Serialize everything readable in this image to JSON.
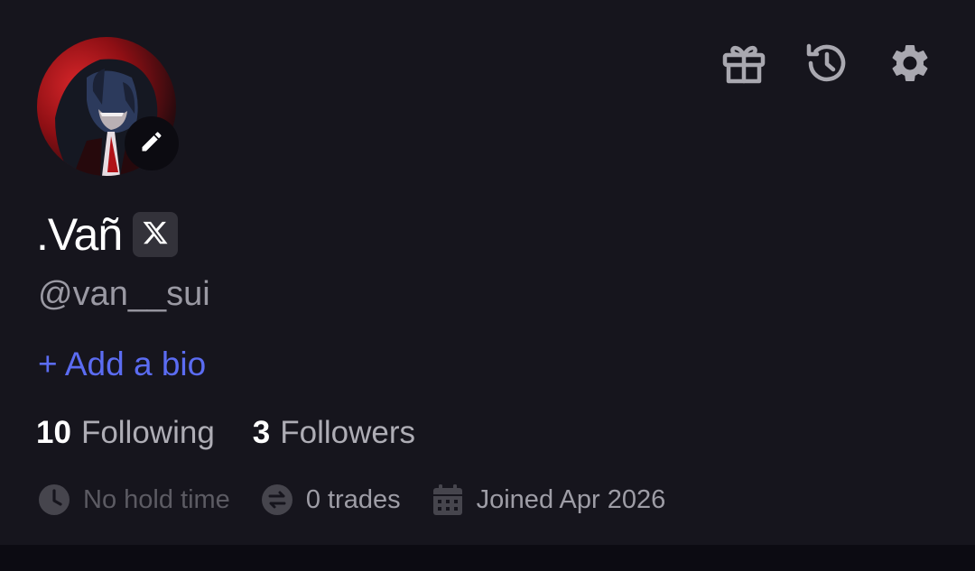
{
  "profile": {
    "display_name": ".Vañ",
    "handle": "@van__sui",
    "add_bio_label": "+ Add a bio",
    "stats": {
      "following_count": "10",
      "following_label": "Following",
      "followers_count": "3",
      "followers_label": "Followers"
    },
    "meta": {
      "hold_time": "No hold time",
      "trades": "0 trades",
      "joined": "Joined Apr 2026"
    }
  },
  "icons": {
    "gift": "gift-icon",
    "history": "history-icon",
    "settings": "gear-icon",
    "edit": "pencil-icon",
    "x_badge": "x-logo-icon",
    "clock": "clock-icon",
    "trades": "swap-icon",
    "calendar": "calendar-icon"
  },
  "colors": {
    "background": "#16151d",
    "accent": "#5b6cf2",
    "muted_text": "#9a99a3",
    "dim_text": "#5c5b63",
    "icon": "#a9a8b0"
  }
}
